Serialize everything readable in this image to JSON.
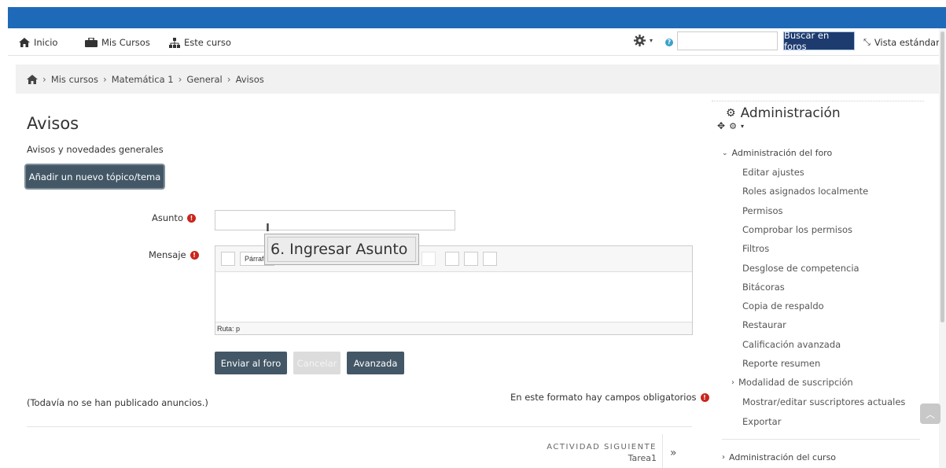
{
  "nav": {
    "home": "Inicio",
    "my_courses": "Mis Cursos",
    "this_course": "Este curso",
    "search_placeholder": "",
    "search_button": "Buscar en foros",
    "standard_view": "Vista estándar"
  },
  "breadcrumb": [
    "Mis cursos",
    "Matemática 1",
    "General",
    "Avisos"
  ],
  "main": {
    "title": "Avisos",
    "subtitle": "Avisos y novedades generales",
    "add_topic_button": "Añadir un nuevo tópico/tema",
    "subject_label": "Asunto",
    "message_label": "Mensaje",
    "format_select": "Párrafo",
    "editor_path": "Ruta: p",
    "tooltip": "6. Ingresar Asunto",
    "submit_button": "Enviar al foro",
    "cancel_button": "Cancelar",
    "advanced_button": "Avanzada",
    "no_posts": "(Todavía no se han publicado anuncios.)",
    "required_note": "En este formato hay campos obligatorios",
    "next_activity_label": "ACTIVIDAD SIGUIENTE",
    "next_activity_name": "Tarea1"
  },
  "admin": {
    "title": "Administración",
    "forum_admin": "Administración del foro",
    "items": [
      "Editar ajustes",
      "Roles asignados localmente",
      "Permisos",
      "Comprobar los permisos",
      "Filtros",
      "Desglose de competencia",
      "Bitácoras",
      "Copia de respaldo",
      "Restaurar",
      "Calificación avanzada",
      "Reporte resumen"
    ],
    "subscription_mode": "Modalidad de suscripción",
    "more_items": [
      "Mostrar/editar suscriptores actuales",
      "Exportar"
    ],
    "course_admin": "Administración del curso"
  },
  "colors": {
    "top_band": "#1f6ab8",
    "search_button": "#1d3b6e",
    "dark_button": "#435766",
    "required": "#c9261c"
  }
}
